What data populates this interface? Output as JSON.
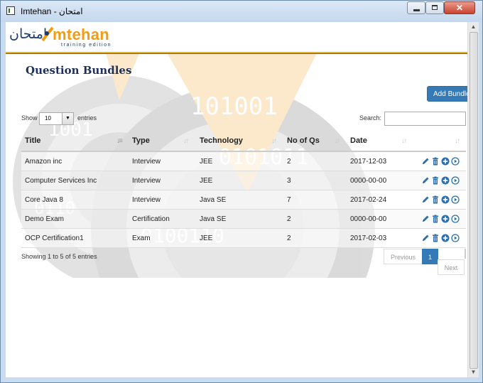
{
  "window": {
    "title": "Imtehan - امتحان",
    "close_glyph": "✕"
  },
  "brand": {
    "logo_arabic": "امتحان",
    "logo_main": "mtehan",
    "logo_tagline": "training edition",
    "accent_color": "#f39c12",
    "navy_color": "#1e3a6e"
  },
  "page": {
    "title": "Question Bundles",
    "add_button_label": "Add Bundle"
  },
  "table_controls": {
    "show_label": "Show",
    "entries_value": "10",
    "entries_label": "entries",
    "search_label": "Search:",
    "search_value": ""
  },
  "table": {
    "columns": [
      "Title",
      "Type",
      "Technology",
      "No of Qs",
      "Date"
    ],
    "rows": [
      {
        "title": "Amazon inc",
        "type": "Interview",
        "technology": "JEE",
        "count": "2",
        "date": "2017-12-03"
      },
      {
        "title": "Computer Services Inc",
        "type": "Interview",
        "technology": "JEE",
        "count": "3",
        "date": "0000-00-00"
      },
      {
        "title": "Core Java 8",
        "type": "Interview",
        "technology": "Java SE",
        "count": "7",
        "date": "2017-02-24"
      },
      {
        "title": "Demo Exam",
        "type": "Certification",
        "technology": "Java SE",
        "count": "2",
        "date": "0000-00-00"
      },
      {
        "title": "OCP Certification1",
        "type": "Exam",
        "technology": "JEE",
        "count": "2",
        "date": "2017-02-03"
      }
    ],
    "row_action_icons": [
      "pencil-icon",
      "trash-icon",
      "add-circle-icon",
      "play-circle-icon"
    ]
  },
  "footer": {
    "info": "Showing 1 to 5 of 5 entries",
    "previous": "Previous",
    "page": "1",
    "next": "Next"
  }
}
